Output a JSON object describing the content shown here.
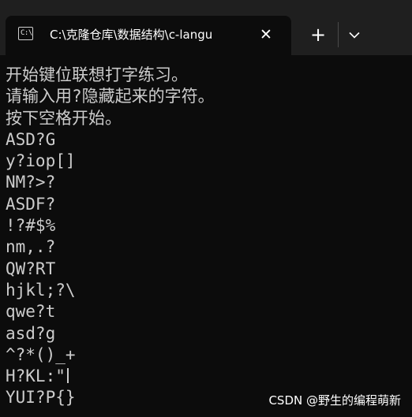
{
  "tab": {
    "icon": "terminal-icon",
    "icon_glyph": "C:\\",
    "title": "C:\\克隆仓库\\数据结构\\c-langu",
    "close_label": "✕"
  },
  "titlebar": {
    "new_tab_label": "+",
    "dropdown_icon": "chevron-down-icon"
  },
  "terminal": {
    "lines": [
      "开始键位联想打字练习。",
      "请输入用?隐藏起来的字符。",
      "按下空格开始。",
      "ASD?G",
      "y?iop[]",
      "NM?>?",
      "ASDF?",
      "!?#$%",
      "nm,.?",
      "QW?RT",
      "hjkl;?\\",
      "qwe?t",
      "asd?g",
      "^?*()_+",
      "H?KL:\"",
      "YUI?P{}"
    ],
    "cursor_line_index": 14
  },
  "watermark": "CSDN @野生的编程萌新",
  "colors": {
    "background": "#0c0c0c",
    "titlebar": "#1f1f1f",
    "text": "#cccccc"
  }
}
